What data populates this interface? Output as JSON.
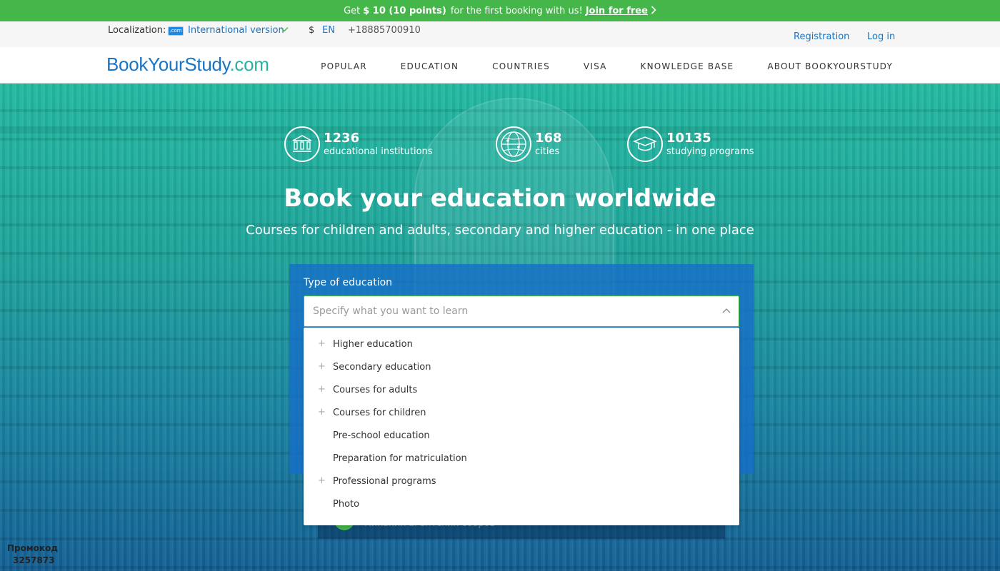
{
  "promo": {
    "text_before": "Get",
    "amount": "$ 10 (10 points)",
    "text_after": "for the first booking with us!",
    "join_label": "Join for free"
  },
  "utility": {
    "localization_label": "Localization:",
    "flag_text": ".com",
    "version_label": "International version",
    "currency": "$",
    "language": "EN",
    "phone": "+18885700910",
    "registration_label": "Registration",
    "login_label": "Log in"
  },
  "header": {
    "logo_part1": "BookYourStudy",
    "logo_part2": ".com",
    "nav": [
      "POPULAR",
      "EDUCATION",
      "COUNTRIES",
      "VISA",
      "KNOWLEDGE BASE",
      "ABOUT BOOKYOURSTUDY"
    ]
  },
  "stats": [
    {
      "number": "1236",
      "label": "educational institutions",
      "icon": "institution-icon"
    },
    {
      "number": "168",
      "label": "cities",
      "icon": "globe-icon"
    },
    {
      "number": "10135",
      "label": "studying programs",
      "icon": "graduation-cap-icon"
    }
  ],
  "hero": {
    "title": "Book your education worldwide",
    "subtitle": "Courses for children and adults, secondary and higher education - in one place"
  },
  "search": {
    "type_label": "Type of education",
    "placeholder": "Specify what you want to learn",
    "options": [
      {
        "label": "Higher education",
        "expandable": true
      },
      {
        "label": "Secondary education",
        "expandable": true
      },
      {
        "label": "Courses for adults",
        "expandable": true
      },
      {
        "label": "Courses for children",
        "expandable": true
      },
      {
        "label": "Pre-school education",
        "expandable": false
      },
      {
        "label": "Preparation for matriculation",
        "expandable": false
      },
      {
        "label": "Professional programs",
        "expandable": true
      },
      {
        "label": "Photo",
        "expandable": false
      }
    ]
  },
  "partially_hidden_text": "Никаких агентских сборов",
  "promo_code": {
    "label": "Промокод",
    "code": "3257873"
  },
  "colors": {
    "accent_green": "#45b649",
    "link_blue": "#1a74c4",
    "logo_teal": "#2bb1a0"
  }
}
